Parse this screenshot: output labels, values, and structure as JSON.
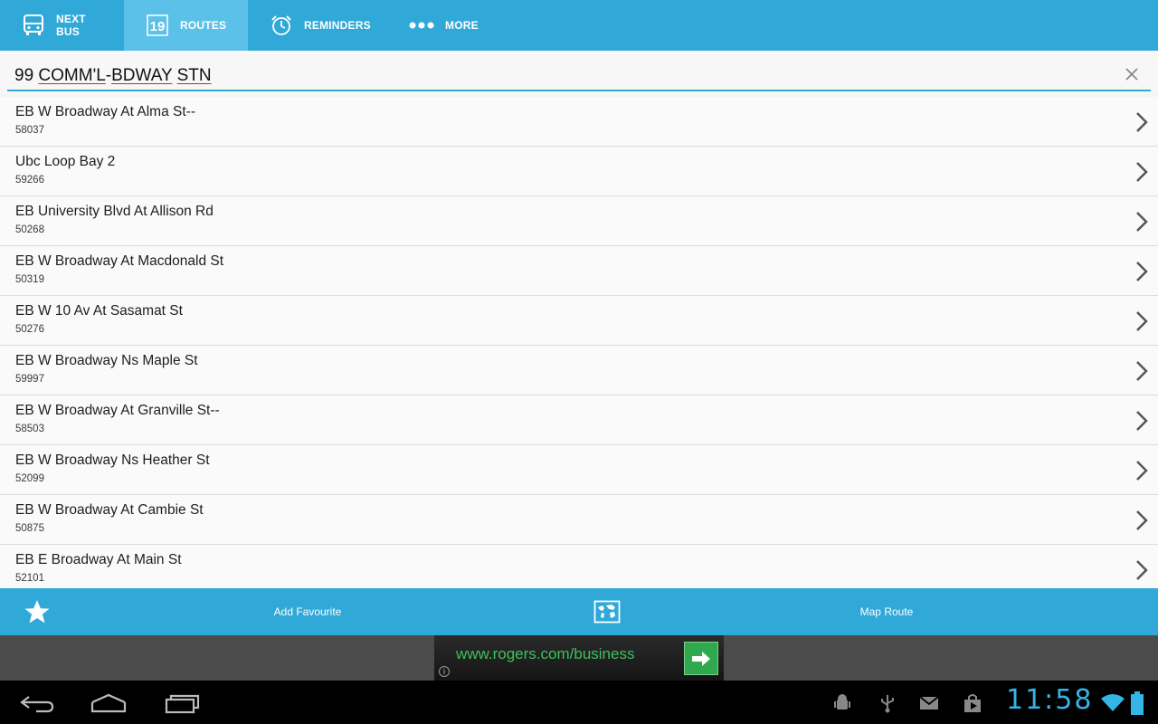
{
  "tabs": [
    {
      "label": "NEXT BUS",
      "icon": "bus-icon"
    },
    {
      "label": "ROUTES",
      "icon": "calendar-19-icon",
      "icon_text": "19",
      "active": true
    },
    {
      "label": "REMINDERS",
      "icon": "alarm-clock-icon"
    },
    {
      "label": "MORE",
      "icon": "more-dots-icon"
    }
  ],
  "search": {
    "value_prefix": "99 ",
    "value_parts": [
      "COMM'L",
      "-",
      "BDWAY",
      " ",
      "STN"
    ]
  },
  "stops": [
    {
      "name": "EB W Broadway At Alma St--",
      "code": "58037"
    },
    {
      "name": "Ubc Loop Bay 2",
      "code": "59266"
    },
    {
      "name": "EB University Blvd At Allison Rd",
      "code": "50268"
    },
    {
      "name": "EB W Broadway At Macdonald St",
      "code": "50319"
    },
    {
      "name": "EB W 10 Av At Sasamat St",
      "code": "50276"
    },
    {
      "name": "EB W Broadway Ns Maple St",
      "code": "59997"
    },
    {
      "name": "EB W Broadway At Granville St--",
      "code": "58503"
    },
    {
      "name": "EB W Broadway Ns Heather St",
      "code": "52099"
    },
    {
      "name": "EB W Broadway At Cambie St",
      "code": "50875"
    },
    {
      "name": "EB E Broadway At Main St",
      "code": "52101"
    }
  ],
  "actions": {
    "add_favourite": "Add Favourite",
    "map_route": "Map Route"
  },
  "ad": {
    "url": "www.rogers.com/business",
    "info": "i"
  },
  "status": {
    "clock": "11:58"
  },
  "colors": {
    "accent": "#30a9d8",
    "active_tab": "#5cc1e9",
    "ad_green": "#3cc15c",
    "clock": "#33b5e5"
  }
}
